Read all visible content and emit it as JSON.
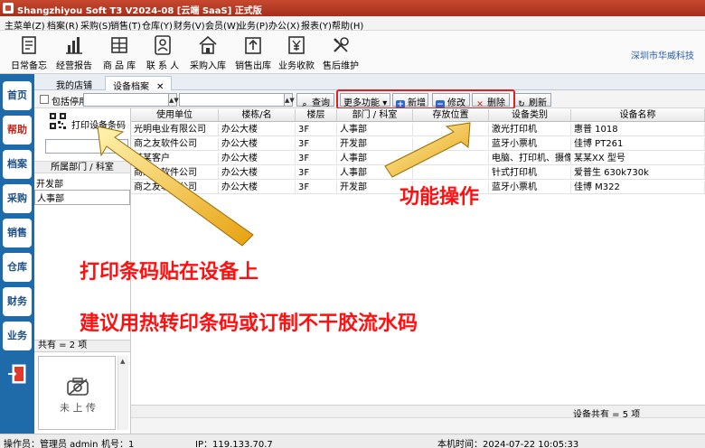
{
  "window": {
    "title": "Shangzhiyou Soft T3 V2024-08 [云端 SaaS] 正式版"
  },
  "menu": [
    {
      "label": "主菜单(Z)"
    },
    {
      "label": "档案(R)"
    },
    {
      "label": "采购(S)"
    },
    {
      "label": "销售(T)"
    },
    {
      "label": "仓库(Y)"
    },
    {
      "label": "财务(V)"
    },
    {
      "label": "会员(W)"
    },
    {
      "label": "业务(P)"
    },
    {
      "label": "办公(X)"
    },
    {
      "label": "报表(Y)"
    },
    {
      "label": "帮助(H)"
    }
  ],
  "toolbar": {
    "items": [
      {
        "label": "日常备忘",
        "icon": "memo-icon"
      },
      {
        "label": "经营报告",
        "icon": "bar-chart-icon"
      },
      {
        "label": "商 品 库",
        "icon": "product-library-icon"
      },
      {
        "label": "联 系 人",
        "icon": "contacts-icon"
      },
      {
        "label": "采购入库",
        "icon": "purchase-in-icon"
      },
      {
        "label": "销售出库",
        "icon": "sales-out-icon"
      },
      {
        "label": "业务收款",
        "icon": "payment-icon"
      },
      {
        "label": "售后维护",
        "icon": "tools-icon"
      }
    ],
    "company": "深圳市华威科技"
  },
  "sidebar": {
    "items": [
      {
        "label": "首页"
      },
      {
        "label": "帮助"
      },
      {
        "label": "档案"
      },
      {
        "label": "采购"
      },
      {
        "label": "销售"
      },
      {
        "label": "仓库"
      },
      {
        "label": "财务"
      },
      {
        "label": "业务"
      }
    ],
    "exit_icon": "exit-door-icon"
  },
  "tabs": [
    {
      "label": "我的店铺"
    },
    {
      "label": "设备档案"
    }
  ],
  "filters": {
    "include_disabled": "包括停用",
    "query": "查询",
    "more": "更多功能",
    "add": "新增",
    "edit": "修改",
    "delete": "删除",
    "refresh": "刷新"
  },
  "left_panel": {
    "print_barcode": "打印设备条码",
    "dept_header": "所属部门 / 科室",
    "departments": [
      "开发部",
      "人事部"
    ],
    "total": "共有 = 2 项",
    "photo_status": "未 上 传"
  },
  "grid": {
    "columns": [
      "使用单位",
      "楼栋/名",
      "楼层",
      "部门 / 科室",
      "存放位置",
      "设备类别",
      "设备名称"
    ],
    "rows": [
      [
        "光明电业有限公司",
        "办公大楼",
        "3F",
        "人事部",
        "",
        "激光打印机",
        "惠普 1018"
      ],
      [
        "商之友软件公司",
        "办公大楼",
        "3F",
        "开发部",
        "",
        "蓝牙小票机",
        "佳博 PT261"
      ],
      [
        "某某客户",
        "办公大楼",
        "3F",
        "人事部",
        "",
        "电脑、打印机、摄像枪",
        "某某XX 型号"
      ],
      [
        "商之友软件公司",
        "办公大楼",
        "3F",
        "人事部",
        "",
        "针式打印机",
        "爱普生 630k730k"
      ],
      [
        "商之友软件公司",
        "办公大楼",
        "3F",
        "开发部",
        "",
        "蓝牙小票机",
        "佳博 M322"
      ]
    ],
    "footer": "设备共有 = 5 项"
  },
  "status": {
    "operator": "操作员：管理员 admin",
    "machine": "机号：1",
    "ip": "IP：119.133.70.7",
    "time": "本机时间：2024-07-22 10:05:33"
  },
  "annotations": {
    "function_ops": "功能操作",
    "print_tip": "打印条码贴在设备上",
    "suggest_tip": "建议用热转印条码或订制不干胶流水码"
  },
  "colors": {
    "titlebar": "#b8391f",
    "sidebar": "#1f6aa9",
    "annotation": "#ff1010",
    "arrow": "#f2b31c"
  }
}
